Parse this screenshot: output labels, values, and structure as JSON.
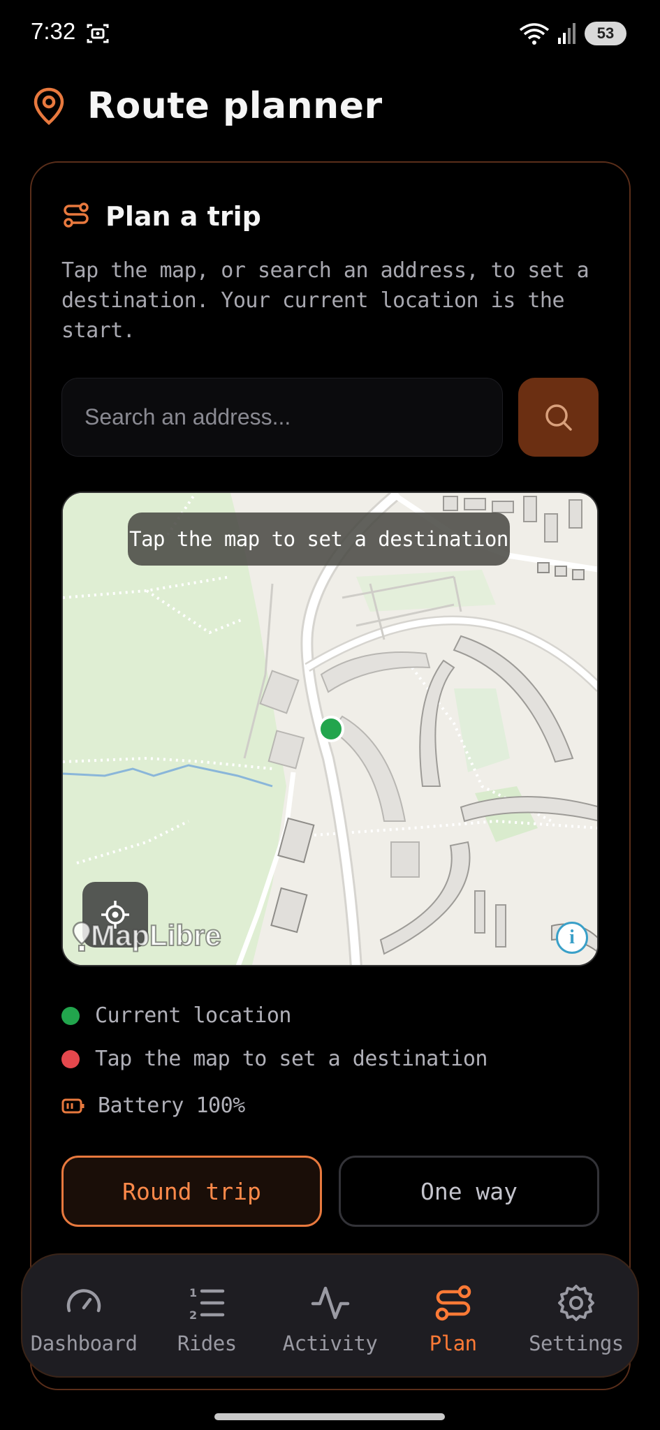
{
  "status_bar": {
    "time": "7:32",
    "battery": "53",
    "screen_icon": "screenshot-icon",
    "wifi_icon": "wifi-icon",
    "signal_icon": "signal-icon"
  },
  "header": {
    "title": "Route planner",
    "icon": "map-pin-icon"
  },
  "plan_card": {
    "title": "Plan a trip",
    "icon": "route-icon",
    "description": "Tap the map, or search an address, to set a destination. Your current location is the start.",
    "search": {
      "placeholder": "Search an address...",
      "value": ""
    },
    "map": {
      "tooltip": "Tap the map to set a destination",
      "attribution": "MapLibre",
      "info_label": "i"
    },
    "legend": {
      "current_location": "Current location",
      "destination": "Tap the map to set a destination",
      "battery": "Battery 100%"
    },
    "trip_types": {
      "round_trip": "Round trip",
      "one_way": "One way",
      "selected": "Round trip"
    }
  },
  "nav": {
    "items": [
      {
        "label": "Dashboard",
        "icon": "gauge-icon"
      },
      {
        "label": "Rides",
        "icon": "list-ordered-icon"
      },
      {
        "label": "Activity",
        "icon": "activity-icon"
      },
      {
        "label": "Plan",
        "icon": "route-icon"
      },
      {
        "label": "Settings",
        "icon": "gear-icon"
      }
    ],
    "active": "Plan"
  },
  "colors": {
    "accent": "#e8793e",
    "current_location": "#22a54d",
    "destination": "#e5484d",
    "background": "#000000"
  }
}
